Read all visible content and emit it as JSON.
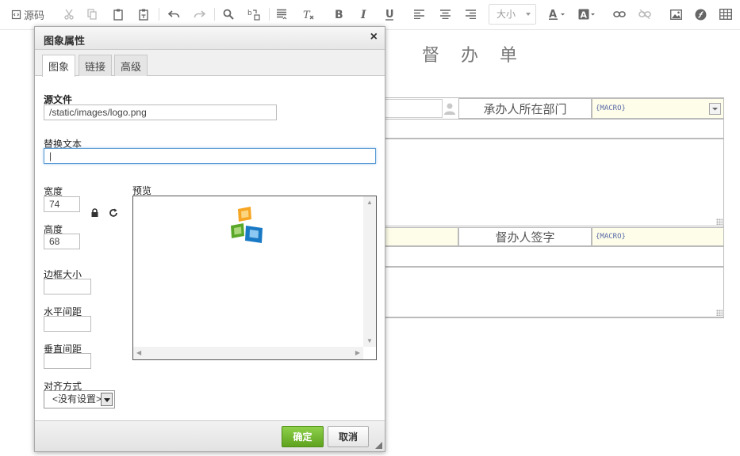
{
  "toolbar": {
    "source_label": "源码",
    "font_size_placeholder": "大小"
  },
  "document": {
    "title": "督 办 单",
    "handler_dept_label": "承办人所在部门",
    "supervisor_sign_label": "督办人签字",
    "macro_1": "{MACRO}",
    "macro_2": "{MACRO}"
  },
  "dialog": {
    "title": "图象属性",
    "close_symbol": "×",
    "tabs": [
      {
        "label": "图象"
      },
      {
        "label": "链接"
      },
      {
        "label": "高级"
      }
    ],
    "source_file_label": "源文件",
    "source_file_value": "/static/images/logo.png",
    "alt_text_label": "替换文本",
    "alt_text_value": "|",
    "width_label": "宽度",
    "width_value": "74",
    "height_label": "高度",
    "height_value": "68",
    "preview_label": "预览",
    "border_label": "边框大小",
    "hspace_label": "水平间距",
    "vspace_label": "垂直间距",
    "align_label": "对齐方式",
    "align_value": "<没有设置>",
    "ok_label": "确定",
    "cancel_label": "取消"
  },
  "colors": {
    "ok_button": "#6ab22a",
    "focus_border": "#5b9bd5",
    "macro_text": "#5b6aa8"
  }
}
